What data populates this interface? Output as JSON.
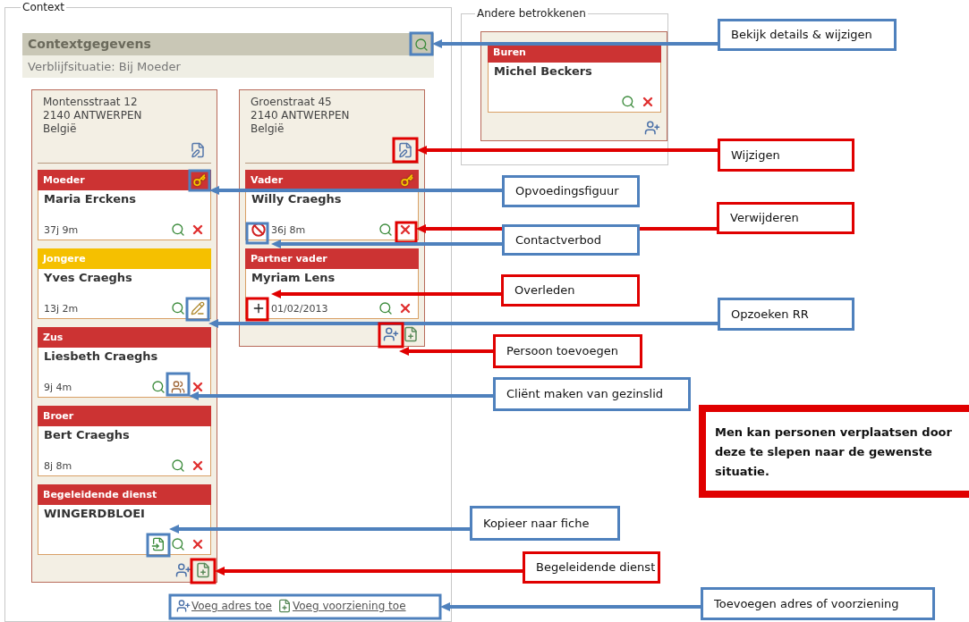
{
  "context": {
    "legend": "Context",
    "summary": {
      "title": "Contextgegevens",
      "subtitle": "Verblijfsituatie: Bij Moeder"
    },
    "addresses": [
      {
        "lines": [
          "Montensstraat 12",
          "2140 ANTWERPEN",
          "België"
        ],
        "members": [
          {
            "role": "Moeder",
            "color": "#cc3333",
            "name": "Maria Erckens",
            "key": true,
            "detail": "37j 9m",
            "actions": [
              {
                "kind": "view"
              },
              {
                "kind": "delete"
              }
            ]
          },
          {
            "role": "Jongere",
            "color": "#f5c000",
            "name": "Yves Craeghs",
            "key": false,
            "detail": "13j 2m",
            "actions": [
              {
                "kind": "view"
              },
              {
                "kind": "lookup"
              }
            ]
          },
          {
            "role": "Zus",
            "color": "#cc3333",
            "name": "Liesbeth Craeghs",
            "key": false,
            "detail": "9j 4m",
            "actions": [
              {
                "kind": "view"
              },
              {
                "kind": "make-client"
              },
              {
                "kind": "delete"
              }
            ]
          },
          {
            "role": "Broer",
            "color": "#cc3333",
            "name": "Bert Craeghs",
            "key": false,
            "detail": "8j 8m",
            "actions": [
              {
                "kind": "view"
              },
              {
                "kind": "delete"
              }
            ]
          },
          {
            "role": "Begeleidende dienst",
            "color": "#cc3333",
            "name": "WINGERDBLOEI",
            "key": false,
            "actions": [
              {
                "kind": "copy"
              },
              {
                "kind": "view"
              },
              {
                "kind": "delete"
              }
            ]
          }
        ],
        "footer": [
          {
            "kind": "add-person"
          },
          {
            "kind": "add-service"
          }
        ]
      },
      {
        "lines": [
          "Groenstraat 45",
          "2140 ANTWERPEN",
          "België"
        ],
        "members": [
          {
            "role": "Vader",
            "color": "#cc3333",
            "name": "Willy Craeghs",
            "key": true,
            "badge": {
              "kind": "no-contact"
            },
            "detail": "36j 8m",
            "actions": [
              {
                "kind": "view"
              },
              {
                "kind": "delete"
              }
            ]
          },
          {
            "role": "Partner vader",
            "color": "#cc3333",
            "name": "Myriam Lens",
            "key": false,
            "badge": {
              "kind": "deceased"
            },
            "detail": "01/02/2013",
            "actions": [
              {
                "kind": "view"
              },
              {
                "kind": "delete"
              }
            ]
          }
        ],
        "footer": [
          {
            "kind": "add-person"
          },
          {
            "kind": "add-service"
          }
        ]
      }
    ],
    "links": [
      "Voeg adres toe",
      "Voeg voorziening toe"
    ]
  },
  "others": {
    "legend": "Andere betrokkenen",
    "members": [
      {
        "role": "Buren",
        "color": "#cc3333",
        "name": "Michel Beckers",
        "key": false,
        "actions": [
          {
            "kind": "view"
          },
          {
            "kind": "delete"
          }
        ]
      }
    ],
    "footer": [
      {
        "kind": "add-person"
      }
    ]
  },
  "callouts": [
    {
      "text": "Bekijk details & wijzigen",
      "color": "#4f81bd"
    },
    {
      "text": "Wijzigen",
      "color": "#e00000"
    },
    {
      "text": "Opvoedingsfiguur",
      "color": "#4f81bd"
    },
    {
      "text": "Verwijderen",
      "color": "#e00000"
    },
    {
      "text": "Contactverbod",
      "color": "#4f81bd"
    },
    {
      "text": "Overleden",
      "color": "#e00000"
    },
    {
      "text": "Opzoeken RR",
      "color": "#4f81bd"
    },
    {
      "text": "Persoon toevoegen",
      "color": "#e00000"
    },
    {
      "text": "Cliënt maken van gezinslid",
      "color": "#4f81bd"
    },
    {
      "text": "Kopieer naar fiche",
      "color": "#4f81bd"
    },
    {
      "text": "Begeleidende dienst",
      "color": "#e00000"
    },
    {
      "text": "Toevoegen adres of voorziening",
      "color": "#4f81bd"
    }
  ],
  "note": {
    "text": "Men kan personen verplaatsen door deze te slepen naar de gewenste situatie.",
    "color": "#e00000"
  }
}
